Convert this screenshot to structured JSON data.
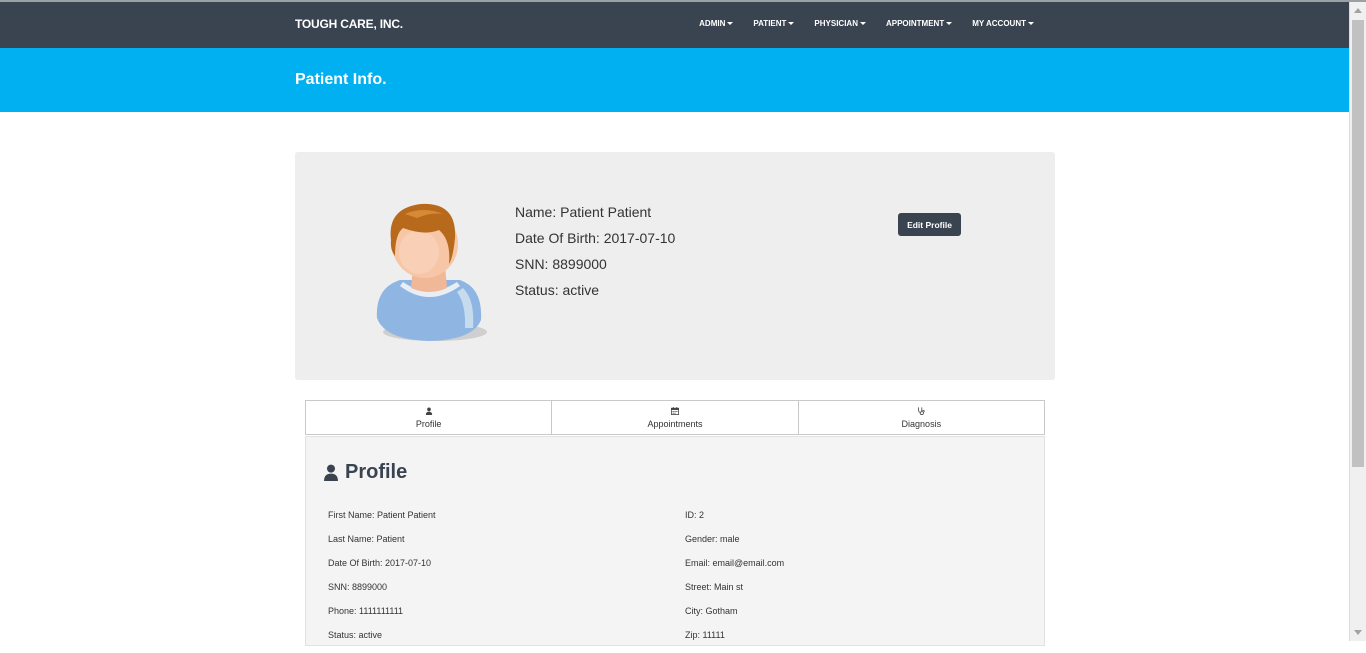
{
  "navbar": {
    "brand": "TOUGH CARE, INC.",
    "menu": [
      "ADMIN",
      "PATIENT",
      "PHYSICIAN",
      "APPOINTMENT",
      "MY ACCOUNT"
    ]
  },
  "banner": {
    "title": "Patient Info."
  },
  "card": {
    "name": "Name: Patient Patient",
    "dob": "Date Of Birth: 2017-07-10",
    "snn": "SNN: 8899000",
    "status": "Status: active",
    "edit_label": "Edit Profile"
  },
  "tabs": [
    {
      "label": "Profile",
      "icon": "user-icon"
    },
    {
      "label": "Appointments",
      "icon": "calendar-icon"
    },
    {
      "label": "Diagnosis",
      "icon": "stethoscope-icon"
    }
  ],
  "profile": {
    "title": "Profile",
    "left": [
      "First Name: Patient Patient",
      "Last Name: Patient",
      "Date Of Birth: 2017-07-10",
      "SNN: 8899000",
      "Phone: 1111111111",
      "Status: active"
    ],
    "right": [
      "ID: 2",
      "Gender: male",
      "Email: email@email.com",
      "Street: Main st",
      "City: Gotham",
      "Zip: 11111"
    ]
  },
  "colors": {
    "navbar": "#3a4350",
    "banner": "#00b0f0",
    "card": "#eeeeee"
  }
}
